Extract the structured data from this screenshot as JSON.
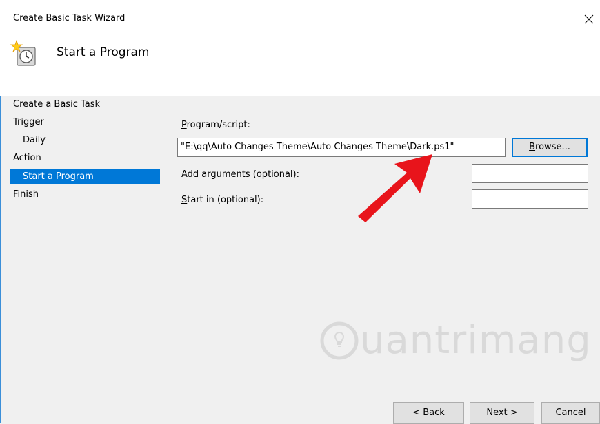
{
  "window": {
    "title": "Create Basic Task Wizard",
    "close_glyph": "✕"
  },
  "header": {
    "title": "Start a Program",
    "icon": "task-scheduler-clock-icon"
  },
  "nav": {
    "items": [
      {
        "label": "Create a Basic Task",
        "selected": false
      },
      {
        "label": "Trigger",
        "selected": false
      },
      {
        "label": "Daily",
        "selected": false
      },
      {
        "label": "Action",
        "selected": false
      },
      {
        "label": "Start a Program",
        "selected": true
      },
      {
        "label": "Finish",
        "selected": false
      }
    ]
  },
  "form": {
    "program": {
      "mnemonic": "P",
      "rest": "rogram/script:",
      "value": "\"E:\\qq\\Auto Changes Theme\\Auto Changes Theme\\Dark.ps1\""
    },
    "browse": {
      "mnemonic": "B",
      "rest": "rowse..."
    },
    "arguments": {
      "mnemonic": "A",
      "rest": "dd arguments (optional):",
      "value": ""
    },
    "start_in": {
      "mnemonic": "S",
      "rest": "tart in (optional):",
      "value": ""
    }
  },
  "footer": {
    "back": {
      "prefix": "< ",
      "mnemonic": "B",
      "rest": "ack"
    },
    "next": {
      "mnemonic": "N",
      "rest": "ext >"
    },
    "cancel": {
      "label": "Cancel"
    }
  },
  "watermark": {
    "text": "uantrimang",
    "logo": "quantrimang-bulb-logo"
  },
  "colors": {
    "accent": "#0078d7",
    "arrow": "#e8141b",
    "window_bg": "#f0f0f0"
  }
}
